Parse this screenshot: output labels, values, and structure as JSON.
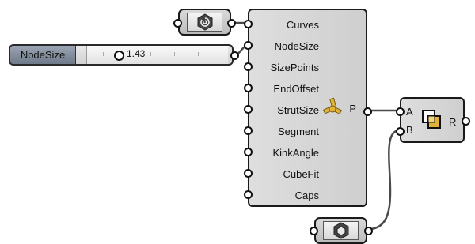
{
  "slider": {
    "label": "NodeSize",
    "value": "1.43"
  },
  "component": {
    "inputs": [
      "Curves",
      "NodeSize",
      "SizePoints",
      "EndOffset",
      "StrutSize",
      "Segment",
      "KinkAngle",
      "CubeFit",
      "Caps"
    ],
    "output": "P"
  },
  "combine": {
    "input_a": "A",
    "input_b": "B",
    "output": "R"
  },
  "icons": {
    "curve_param": "curve-param-icon",
    "main_component": "lattice-node-icon",
    "combine": "union-icon",
    "mesh_param": "mesh-param-icon"
  },
  "colors": {
    "wire": "#4a4a4a",
    "slider_label_bg": "#7d8796",
    "icon_accent": "#e0b43a"
  }
}
